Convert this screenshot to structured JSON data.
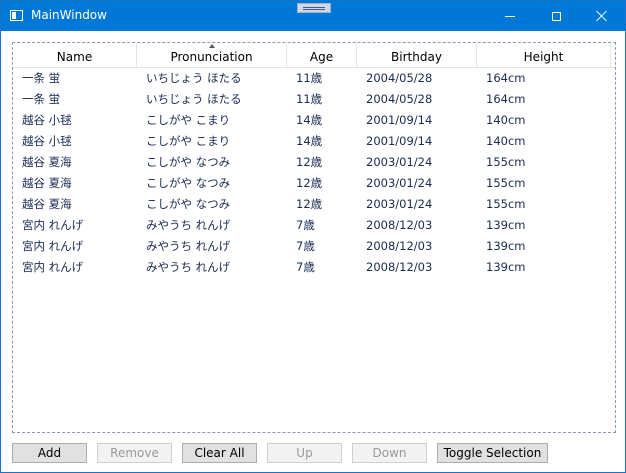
{
  "window": {
    "title": "MainWindow"
  },
  "table": {
    "columns": [
      "Name",
      "Pronunciation",
      "Age",
      "Birthday",
      "Height"
    ],
    "sorted_column": "Pronunciation",
    "rows": [
      [
        "一条 蛍",
        "いちじょう ほたる",
        "11歳",
        "2004/05/28",
        "164cm"
      ],
      [
        "一条 蛍",
        "いちじょう ほたる",
        "11歳",
        "2004/05/28",
        "164cm"
      ],
      [
        "越谷 小毬",
        "こしがや こまり",
        "14歳",
        "2001/09/14",
        "140cm"
      ],
      [
        "越谷 小毬",
        "こしがや こまり",
        "14歳",
        "2001/09/14",
        "140cm"
      ],
      [
        "越谷 夏海",
        "こしがや なつみ",
        "12歳",
        "2003/01/24",
        "155cm"
      ],
      [
        "越谷 夏海",
        "こしがや なつみ",
        "12歳",
        "2003/01/24",
        "155cm"
      ],
      [
        "越谷 夏海",
        "こしがや なつみ",
        "12歳",
        "2003/01/24",
        "155cm"
      ],
      [
        "宮内 れんげ",
        "みやうち れんげ",
        "7歳",
        "2008/12/03",
        "139cm"
      ],
      [
        "宮内 れんげ",
        "みやうち れんげ",
        "7歳",
        "2008/12/03",
        "139cm"
      ],
      [
        "宮内 れんげ",
        "みやうち れんげ",
        "7歳",
        "2008/12/03",
        "139cm"
      ]
    ]
  },
  "buttons": {
    "add": "Add",
    "remove": "Remove",
    "clear_all": "Clear All",
    "up": "Up",
    "down": "Down",
    "toggle_selection": "Toggle Selection"
  },
  "colors": {
    "titlebar": "#0078d7",
    "row_text": "#1a2a50"
  }
}
